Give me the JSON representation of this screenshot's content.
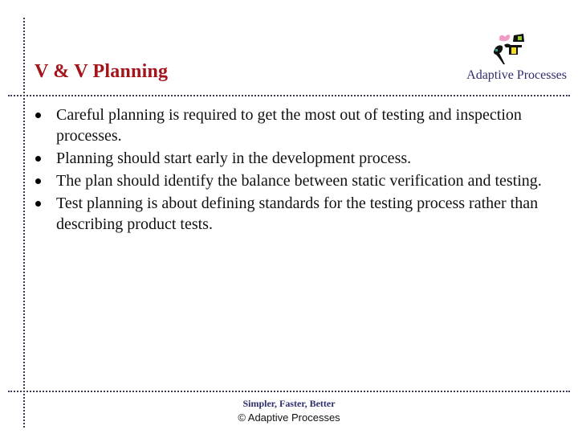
{
  "header": {
    "title": "V & V Planning",
    "brand": "Adaptive Processes",
    "logo_icon": "adaptive-processes-logo-icon"
  },
  "body": {
    "bullets": [
      "Careful planning is required to get the most out of testing and inspection processes.",
      "Planning should start early in the development process.",
      "The plan should identify the balance between static verification and testing.",
      "Test planning is about defining standards for the testing process rather than describing product tests."
    ]
  },
  "footer": {
    "tagline": "Simpler, Faster, Better",
    "copyright": "© Adaptive Processes"
  },
  "colors": {
    "title": "#a3151b",
    "brand": "#2e2d6b",
    "rule": "#3a3a55",
    "text": "#111111"
  }
}
